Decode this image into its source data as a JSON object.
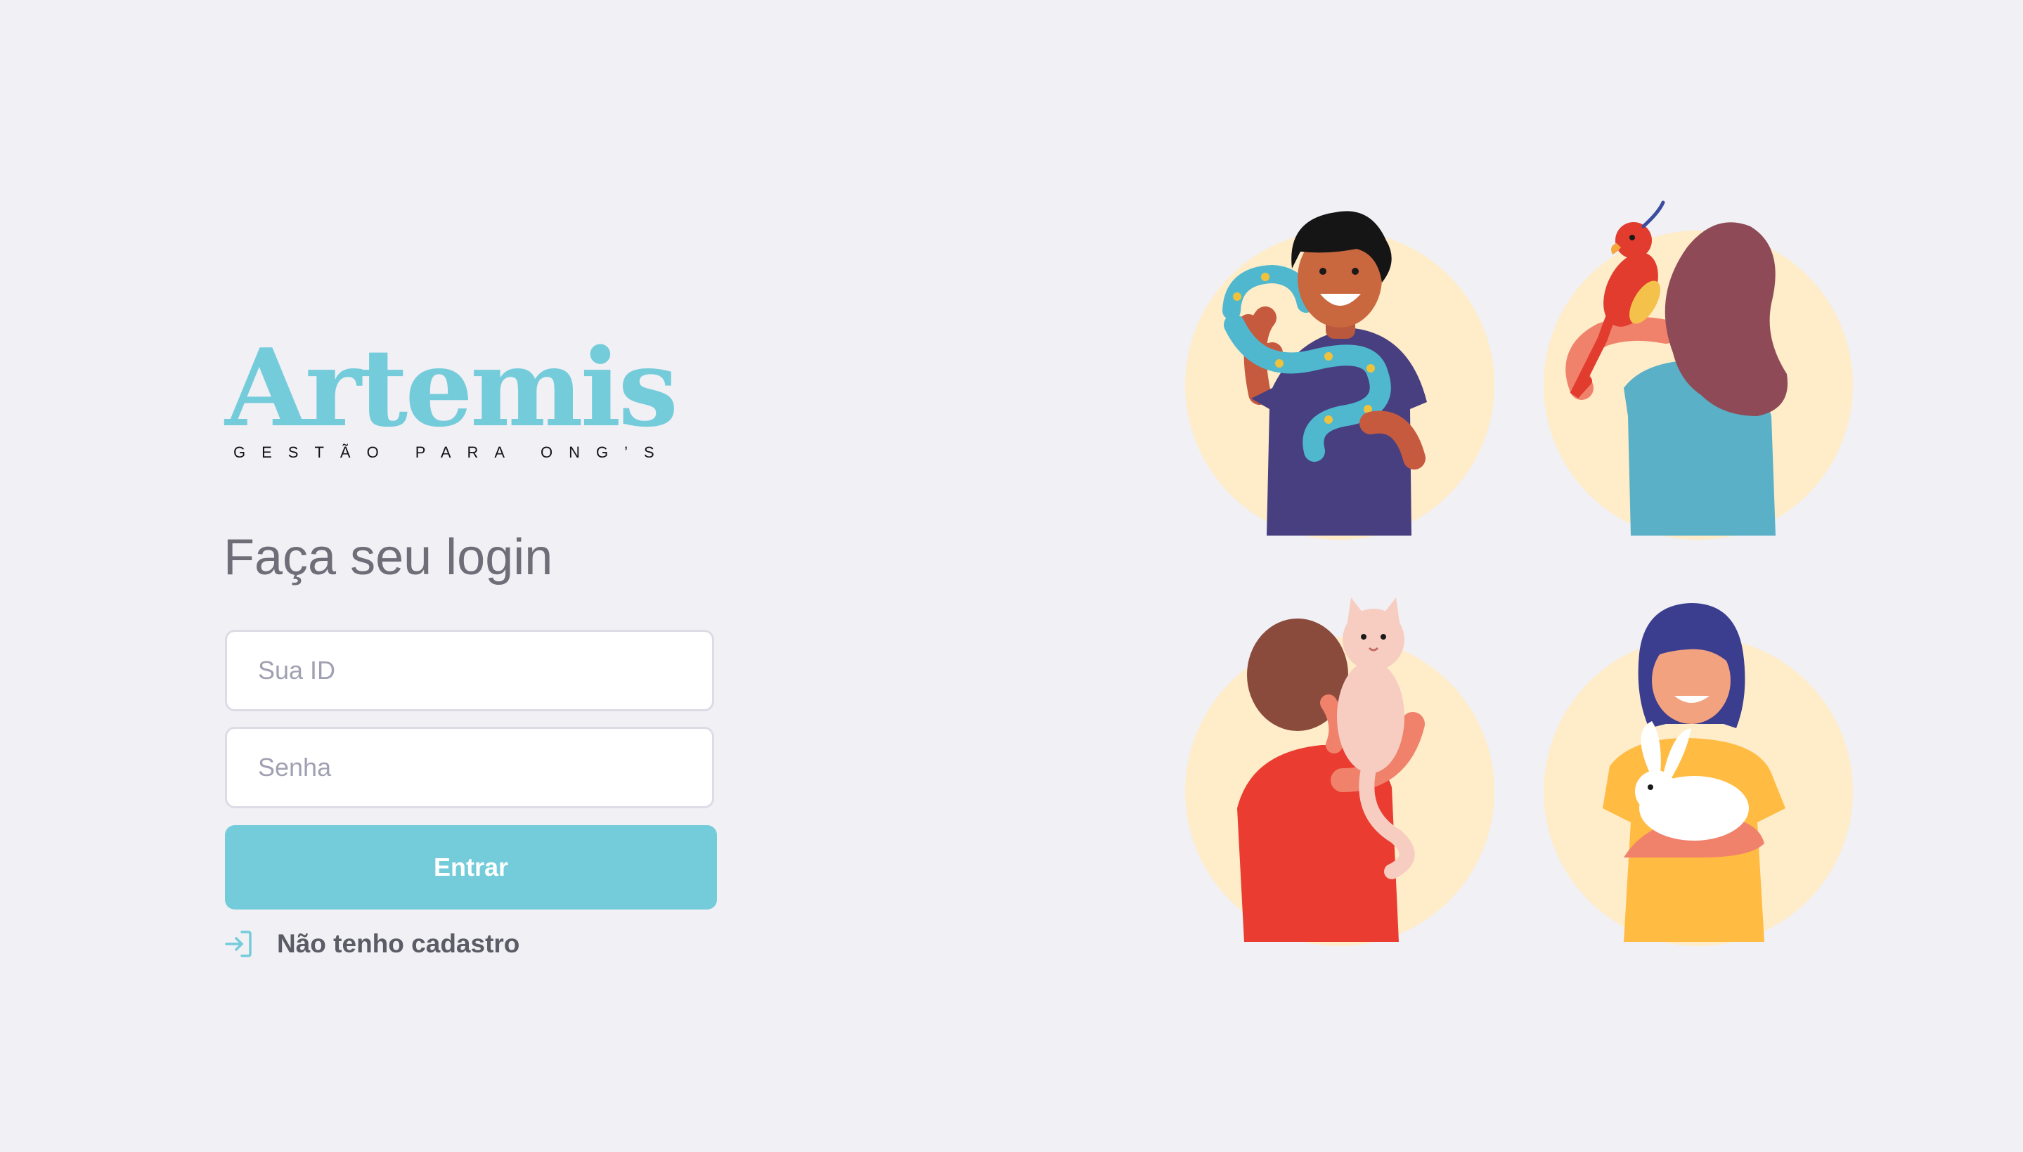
{
  "logo": {
    "name": "Artemis",
    "tagline": "GESTÃO PARA ONG’S"
  },
  "login": {
    "title": "Faça seu login",
    "id_field": {
      "placeholder": "Sua ID",
      "value": ""
    },
    "password_field": {
      "placeholder": "Senha",
      "value": ""
    },
    "submit_label": "Entrar",
    "register_link_label": "Não tenho cadastro"
  },
  "illustrations": [
    {
      "icon": "person-with-snake-illustration"
    },
    {
      "icon": "person-with-parrot-illustration"
    },
    {
      "icon": "person-with-cat-illustration"
    },
    {
      "icon": "person-with-rabbit-illustration"
    }
  ],
  "colors": {
    "background": "#f0f0f5",
    "accent": "#74ccdb",
    "title_text": "#6f6e78",
    "input_border": "#dcdce6",
    "illustration_circle": "#ffecc9"
  }
}
